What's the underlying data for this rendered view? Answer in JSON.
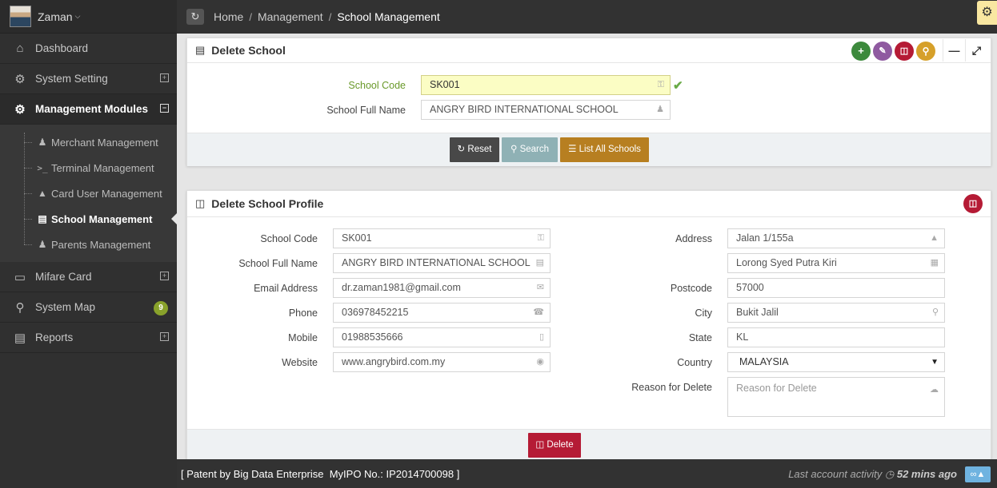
{
  "user": {
    "name": "Zaman"
  },
  "sidebar": {
    "items": [
      {
        "label": "Dashboard",
        "icon": "home-icon"
      },
      {
        "label": "System Setting",
        "icon": "cogs-icon"
      },
      {
        "label": "Management Modules",
        "icon": "cogs-icon"
      },
      {
        "label": "Mifare Card",
        "icon": "credit-card-icon"
      },
      {
        "label": "System Map",
        "icon": "map-marker-icon",
        "badge": "9"
      },
      {
        "label": "Reports",
        "icon": "bar-chart-icon"
      }
    ],
    "subitems": [
      {
        "label": "Merchant Management",
        "icon": "male-icon"
      },
      {
        "label": "Terminal Management",
        "icon": "terminal-icon"
      },
      {
        "label": "Card User Management",
        "icon": "graduation-cap-icon"
      },
      {
        "label": "School Management",
        "icon": "book-icon"
      },
      {
        "label": "Parents Management",
        "icon": "female-icon"
      }
    ]
  },
  "breadcrumb": {
    "home": "Home",
    "management": "Management",
    "current": "School Management"
  },
  "panel1": {
    "title": "Delete School",
    "school_code_label": "School Code",
    "school_code_value": "SK001",
    "school_name_label": "School Full Name",
    "school_name_value": "ANGRY BIRD INTERNATIONAL SCHOOL",
    "reset": "Reset",
    "search": "Search",
    "list_all": "List All Schools"
  },
  "panel2": {
    "title": "Delete School Profile",
    "left": [
      {
        "label": "School Code",
        "value": "SK001"
      },
      {
        "label": "School Full Name",
        "value": "ANGRY BIRD INTERNATIONAL SCHOOL"
      },
      {
        "label": "Email Address",
        "value": "dr.zaman1981@gmail.com"
      },
      {
        "label": "Phone",
        "value": "036978452215"
      },
      {
        "label": "Mobile",
        "value": "01988535666"
      },
      {
        "label": "Website",
        "value": "www.angrybird.com.my"
      }
    ],
    "address_label": "Address",
    "address1": "Jalan 1/155a",
    "address2": "Lorong Syed Putra Kiri",
    "postcode_label": "Postcode",
    "postcode": "57000",
    "city_label": "City",
    "city": "Bukit Jalil",
    "state_label": "State",
    "state": "KL",
    "country_label": "Country",
    "country": "MALAYSIA",
    "reason_label": "Reason for Delete",
    "reason_placeholder": "Reason for Delete",
    "delete": "Delete"
  },
  "footer": {
    "patent": "[ Patent by Big Data Enterprise  MyIPO No.: IP2014700098 ]",
    "last_activity": "Last account activity",
    "time": "52 mins ago"
  },
  "colors": {
    "sidebar": "#303030",
    "highlight_input": "#fbfdc4",
    "green": "#3d8a3d",
    "purple": "#8f5aa0",
    "red": "#b51b35",
    "orange": "#d6a02a",
    "reset_btn": "#484848",
    "search_btn": "#8fb1b5",
    "list_btn": "#b77f21"
  }
}
